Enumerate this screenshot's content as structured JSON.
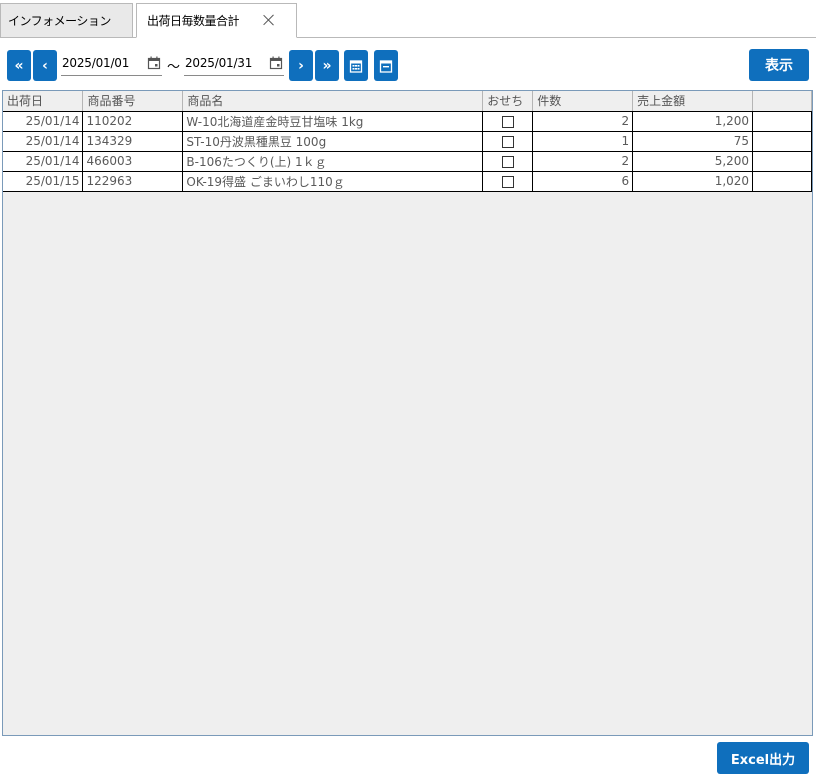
{
  "tabs": [
    {
      "label": "インフォメーション"
    },
    {
      "label": "出荷日毎数量合計"
    }
  ],
  "toolbar": {
    "first_label": "«",
    "prev_label": "‹",
    "next_label": "›",
    "last_label": "»",
    "date_from": "2025/01/01",
    "date_to": "2025/01/31",
    "separator": "〜",
    "show_label": "表示"
  },
  "table": {
    "columns": [
      "出荷日",
      "商品番号",
      "商品名",
      "おせち",
      "件数",
      "売上金額",
      ""
    ],
    "rows": [
      {
        "date": "25/01/14",
        "code": "110202",
        "name": "W-10北海道産金時豆甘塩味 1kg",
        "osechi": false,
        "count": "2",
        "amount": "1,200"
      },
      {
        "date": "25/01/14",
        "code": "134329",
        "name": "ST-10丹波黒種黒豆 100g",
        "osechi": false,
        "count": "1",
        "amount": "75"
      },
      {
        "date": "25/01/14",
        "code": "466003",
        "name": "B-106たつくり(上) 1ｋｇ",
        "osechi": false,
        "count": "2",
        "amount": "5,200"
      },
      {
        "date": "25/01/15",
        "code": "122963",
        "name": "OK-19得盛 ごまいわし110ｇ",
        "osechi": false,
        "count": "6",
        "amount": "1,020"
      }
    ]
  },
  "footer": {
    "excel_label": "Excel出力"
  },
  "colors": {
    "accent": "#0f6fbd",
    "grid_bg": "#efefef"
  }
}
